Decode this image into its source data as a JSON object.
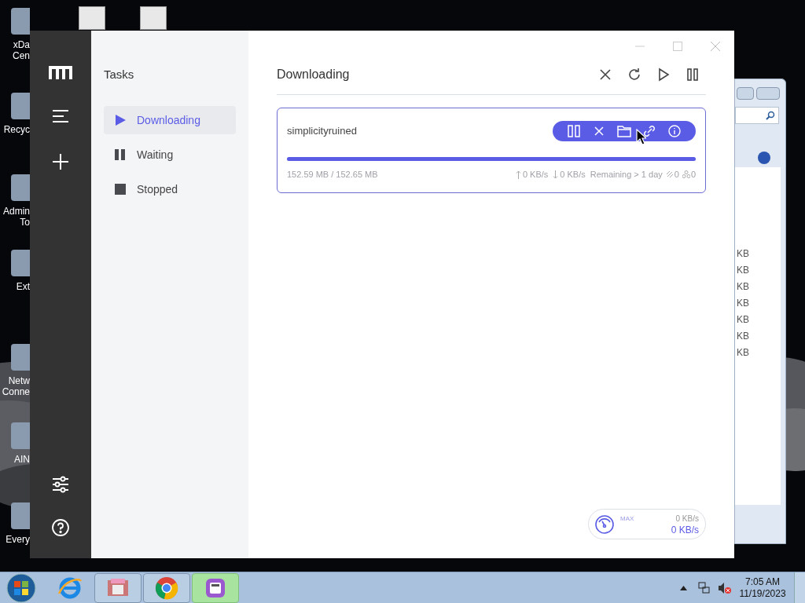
{
  "desktop": {
    "icons": [
      {
        "lines": [
          "xDa",
          "Cen"
        ]
      },
      {
        "lines": [
          "Recyc"
        ]
      },
      {
        "lines": [
          "Admin",
          "To"
        ]
      },
      {
        "lines": [
          "Ext"
        ]
      },
      {
        "lines": [
          "Netw",
          "Conne"
        ]
      },
      {
        "lines": [
          "AIN"
        ]
      },
      {
        "lines": [
          "Every"
        ]
      }
    ]
  },
  "background_window": {
    "sizes": [
      "KB",
      "KB",
      "KB",
      "KB",
      "KB",
      "KB",
      "KB"
    ]
  },
  "app": {
    "sidebar": {
      "title": "Tasks",
      "items": [
        {
          "label": "Downloading",
          "kind": "play",
          "selected": true
        },
        {
          "label": "Waiting",
          "kind": "pause",
          "selected": false
        },
        {
          "label": "Stopped",
          "kind": "stop",
          "selected": false
        }
      ]
    },
    "header": {
      "title": "Downloading"
    },
    "tasks": [
      {
        "name": "simplicityruined",
        "level": 0.9996,
        "size": "152.59 MB / 152.65 MB",
        "upload": "0 KB/s",
        "download": "0 KB/s",
        "remaining": "Remaining > 1 day",
        "connections": "0",
        "peers": "0"
      }
    ],
    "speed": {
      "label": "MAX",
      "upload": "0 KB/s",
      "download": "0 KB/s"
    }
  },
  "taskbar": {
    "apps": [
      {
        "kind": "explorer-app",
        "selected": false
      },
      {
        "kind": "chrome",
        "selected": false
      },
      {
        "kind": "motrix",
        "selected": true
      }
    ],
    "time": "7:05 AM",
    "date": "11/19/2023"
  }
}
